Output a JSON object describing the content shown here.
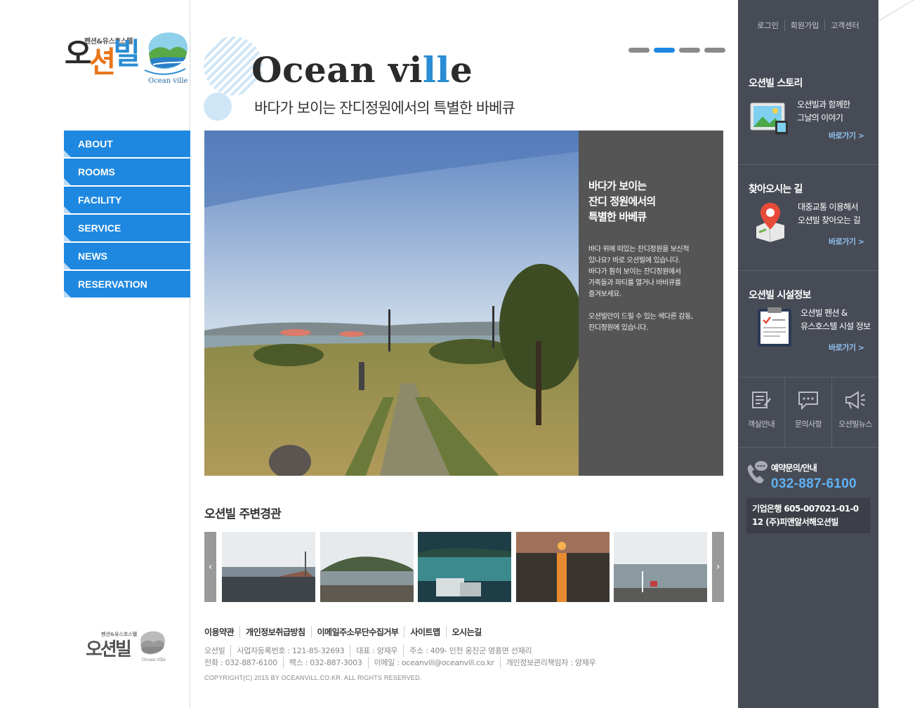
{
  "brand": {
    "logo_small": "펜션&유스호스텔",
    "logo_kor_1": "오",
    "logo_kor_2": "션",
    "logo_kor_3": "빌",
    "logo_en": "Ocean ville",
    "accent_color": "#1e88e0",
    "orange_color": "#e8761a"
  },
  "nav": {
    "items": [
      {
        "label": "ABOUT"
      },
      {
        "label": "ROOMS"
      },
      {
        "label": "FACILITY"
      },
      {
        "label": "SERVICE"
      },
      {
        "label": "NEWS"
      },
      {
        "label": "RESERVATION"
      }
    ]
  },
  "hero": {
    "title_a": "Ocean vi",
    "title_ll": "ll",
    "title_b": "e",
    "subtitle": "바다가 보이는 잔디정원에서의 특별한 바베큐",
    "slide_dots": 4,
    "active_dot": 2,
    "panel_title": [
      "바다가 보이는",
      "잔디 정원에서의",
      "특별한 바베큐"
    ],
    "panel_body_1": [
      "바다 위에 떠있는 잔디정원을 보신적",
      "있나요? 바로 오션빌에 있습니다.",
      "바다가 훤히 보이는 잔디정원에서",
      "가족들과 파티를 열거나 바비큐를",
      "즐겨보세요."
    ],
    "panel_body_2": [
      "오션빌만이 드릴 수 있는 색다른 감동,",
      "잔디정원에 있습니다."
    ]
  },
  "gallery": {
    "title": "오션빌 주변경관",
    "prev_icon": "chevron-left-icon",
    "next_icon": "chevron-right-icon",
    "prev_label": "‹",
    "next_label": "›",
    "thumbs": [
      "beach-photo",
      "island-photo",
      "harbor-photo",
      "sunset-photo",
      "sea-view-photo"
    ]
  },
  "footer": {
    "links": [
      "이용약관",
      "개인정보취급방침",
      "이메일주소무단수집거부",
      "사이트맵",
      "오시는길"
    ],
    "row1": [
      "오션빌",
      "사업자등록번호 : 121-85-32693",
      "대표 : 양재우",
      "주소 : 409- 인천 옹진군 영흥면 선재리"
    ],
    "row2": [
      "전화 : 032-887-6100",
      "팩스 : 032-887-3003",
      "이메일 : oceanvill@oceanvill.co.kr",
      "개인정보관리책임자 : 양재우"
    ],
    "copyright": "COPYRIGHT(C) 2015 BY OCEANVILL.CO.KR. ALL RIGHTS RESERVED."
  },
  "sidebar": {
    "top_links": [
      "로그인",
      "회원가입",
      "고객센터"
    ],
    "story": {
      "title": "오션빌 스토리",
      "desc": [
        "오션빌과 함께한",
        "그날의 이야기"
      ],
      "go": "바로가기 >",
      "icon": "photo-monitor-icon"
    },
    "directions": {
      "title": "찾아오시는 길",
      "desc": [
        "대중교통 이용해서",
        "오션빌 찾아오는 길"
      ],
      "go": "바로가기 >",
      "icon": "map-pin-icon"
    },
    "facility": {
      "title": "오션빌 시설정보",
      "desc": [
        "오션빌 펜션 &",
        "유스호스텔 시설 정보"
      ],
      "go": "바로가기 >",
      "icon": "clipboard-icon"
    },
    "quick": [
      {
        "label": "객실안내",
        "icon": "document-edit-icon"
      },
      {
        "label": "문의사항",
        "icon": "chat-bubble-icon"
      },
      {
        "label": "오션빌뉴스",
        "icon": "megaphone-icon"
      }
    ],
    "contact": {
      "label": "예약문의/안내",
      "phone": "032-887-6100",
      "phone_color": "#5fb3f5",
      "bank": [
        "기업은행  605-007021-01-0",
        "12  (주)피앤알서해오션빌"
      ]
    },
    "bg_color": "#474b55"
  }
}
